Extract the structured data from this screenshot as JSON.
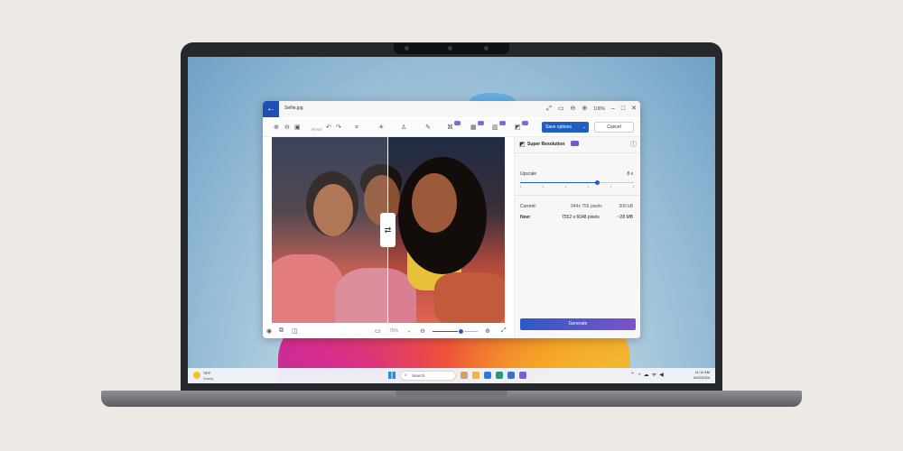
{
  "window": {
    "file_name": "Selfie.jpg",
    "zoom_level": "100%"
  },
  "toolbar": {
    "reset_label": "Reset",
    "save_label": "Save options",
    "cancel_label": "Cancel"
  },
  "canvas": {
    "zoom_value": "75%",
    "zoom_slider_fraction": 0.62
  },
  "panel": {
    "title": "Super Resolution",
    "upscale_label": "Upscale",
    "upscale_value": "8 x",
    "upscale_fraction": 0.68,
    "current_label": "Current:",
    "current_size": "944x 756 pixels",
    "current_file": "300 kB",
    "new_label": "New:",
    "new_size": "7552 x 6048 pixels",
    "new_file": "~28 MB",
    "generate_label": "Generate"
  },
  "taskbar": {
    "temperature": "78°F",
    "condition": "Sunny",
    "search_placeholder": "Search",
    "time": "11:11 AM",
    "date": "6/22/2024"
  },
  "colors": {
    "accent": "#1f5fc4",
    "ai_badge": "#7b6ad8",
    "generate_gradient_start": "#2f58c8",
    "generate_gradient_end": "#7b54c7"
  }
}
